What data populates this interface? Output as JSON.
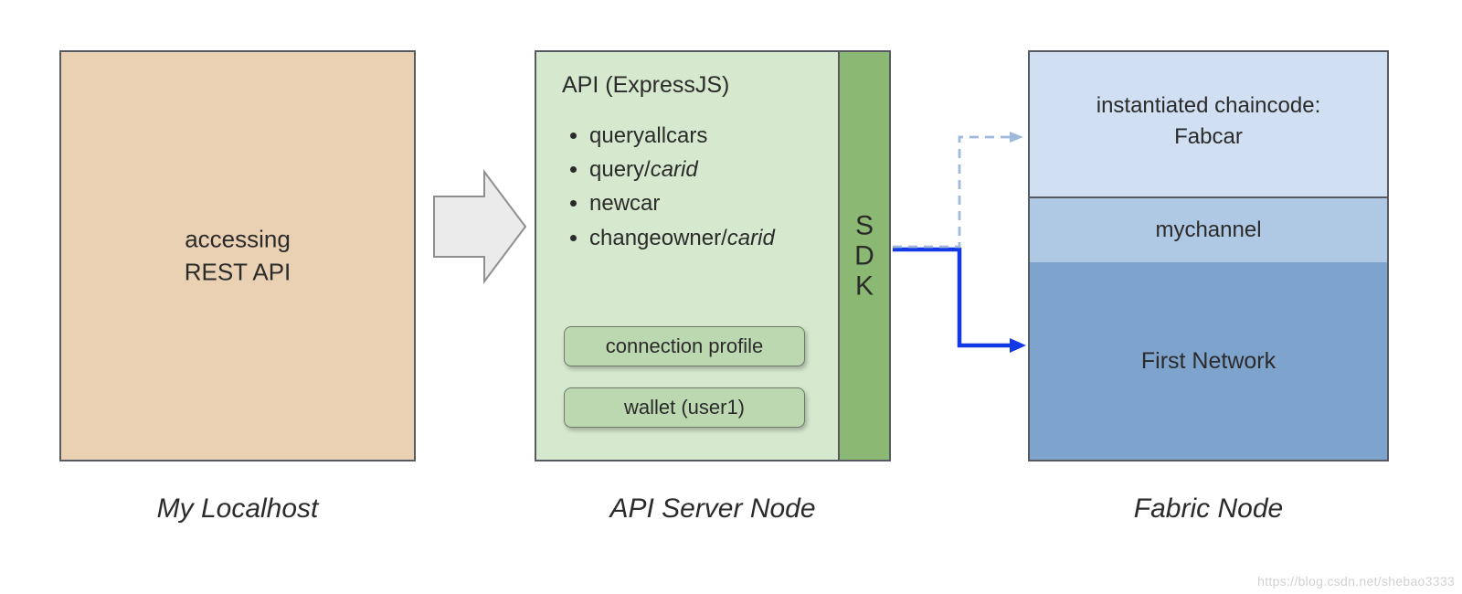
{
  "localhost": {
    "line1": "accessing",
    "line2": "REST API",
    "caption": "My Localhost"
  },
  "api": {
    "title": "API (ExpressJS)",
    "items": {
      "queryallcars": "queryallcars",
      "query_prefix": "query/",
      "query_param": "carid",
      "newcar": "newcar",
      "changeowner_prefix": "changeowner/",
      "changeowner_param": "carid"
    },
    "connection_profile": "connection profile",
    "wallet": "wallet (user1)",
    "sdk_s": "S",
    "sdk_d": "D",
    "sdk_k": "K",
    "caption": "API Server Node"
  },
  "fabric": {
    "chaincode_line1": "instantiated chaincode:",
    "chaincode_line2": "Fabcar",
    "channel": "mychannel",
    "network": "First Network",
    "caption": "Fabric Node"
  },
  "watermark": "https://blog.csdn.net/shebao3333"
}
